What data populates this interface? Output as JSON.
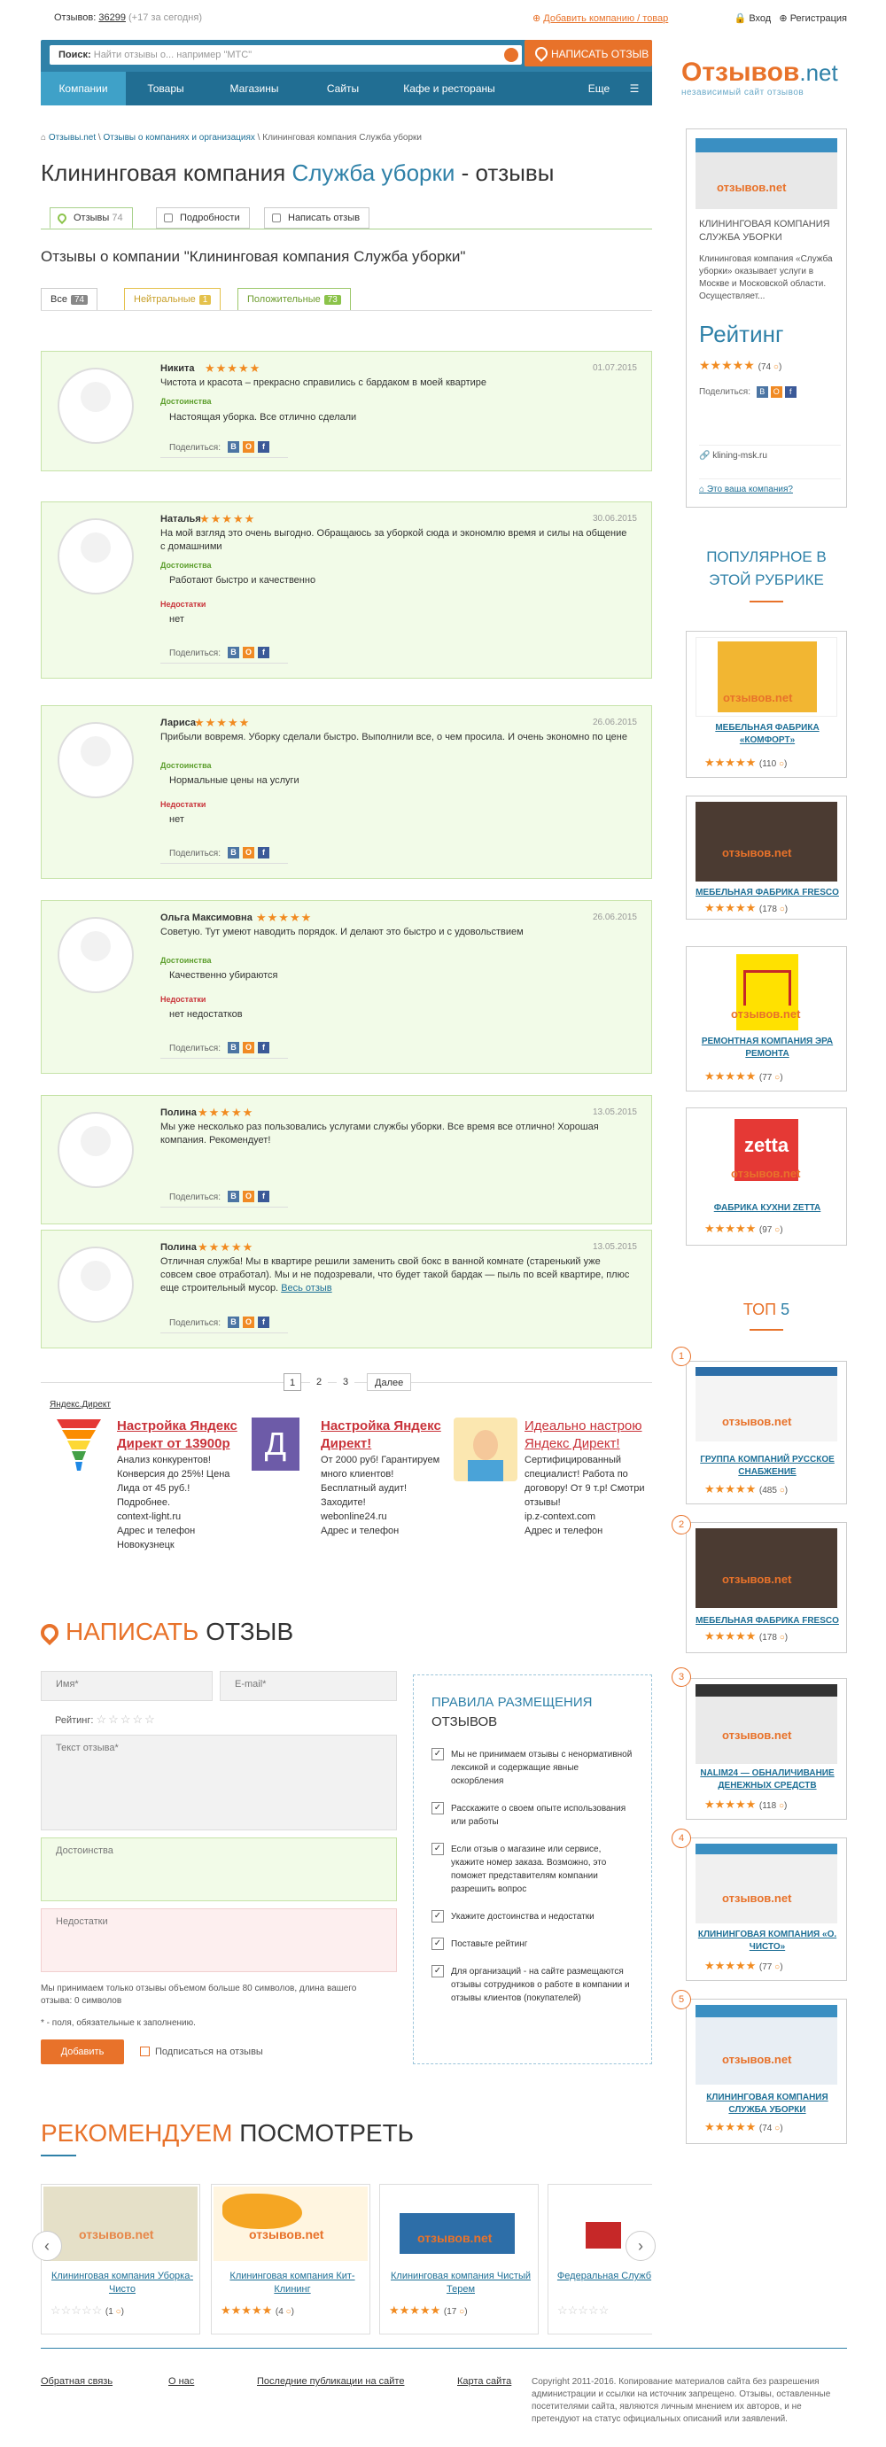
{
  "topbar": {
    "reviews_label": "Отзывов:",
    "reviews_count": "36299",
    "today": "(+17 за сегодня)",
    "add_company": "Добавить компанию / товар",
    "login": "Вход",
    "register": "Регистрация"
  },
  "search": {
    "label": "Поиск:",
    "placeholder": "Найти отзывы о... например \"МТС\"",
    "add_review": "НАПИСАТЬ ОТЗЫВ"
  },
  "nav": [
    "Компании",
    "Товары",
    "Магазины",
    "Сайты",
    "Кафе и рестораны",
    "Еще"
  ],
  "logo": {
    "main": "Отзывов",
    "suffix": ".net",
    "tagline": "независимый сайт отзывов"
  },
  "breadcrumbs": [
    "Отзывы.net",
    "Отзывы о компаниях и организациях",
    "Клининговая компания Служба уборки"
  ],
  "title": {
    "prefix": "Клининговая компания",
    "name": "Служба уборки",
    "suffix": "- отзывы"
  },
  "tabs": [
    {
      "label": "Отзывы",
      "count": "74"
    },
    {
      "label": "Подробности"
    },
    {
      "label": "Написать отзыв"
    }
  ],
  "section_title": "Отзывы о компании \"Клининговая компания Служба уборки\"",
  "filters": [
    {
      "label": "Все",
      "count": "74"
    },
    {
      "label": "Нейтральные",
      "count": "1"
    },
    {
      "label": "Положительные",
      "count": "73"
    }
  ],
  "share_label": "Поделиться:",
  "pros_label": "Достоинства",
  "cons_label": "Недостатки",
  "reviews": [
    {
      "name": "Никита",
      "date": "01.07.2015",
      "text": "Чистота и красота – прекрасно справились с бардаком в моей квартире",
      "pros": "Настоящая уборка. Все отлично сделали",
      "cons": ""
    },
    {
      "name": "Наталья",
      "date": "30.06.2015",
      "text": "На мой взгляд это очень выгодно. Обращаюсь за уборкой сюда и экономлю время и силы на общение с домашними",
      "pros": "Работают быстро и качественно",
      "cons": "нет"
    },
    {
      "name": "Лариса",
      "date": "26.06.2015",
      "text": "Прибыли вовремя. Уборку сделали быстро. Выполнили все, о чем просила. И очень экономно по цене",
      "pros": "Нормальные цены на услуги",
      "cons": "нет"
    },
    {
      "name": "Ольга Максимовна",
      "date": "26.06.2015",
      "text": "Советую. Тут умеют наводить порядок. И делают это быстро и с удовольствием",
      "pros": "Качественно убираются",
      "cons": "нет недостатков"
    },
    {
      "name": "Полина",
      "date": "13.05.2015",
      "text": "Мы уже несколько раз пользовались услугами службы уборки. Все время все отлично! Хорошая компания. Рекомендует!",
      "pros": "",
      "cons": ""
    },
    {
      "name": "Полина",
      "date": "13.05.2015",
      "text": "Отличная служба! Мы в квартире решили заменить свой бокс в ванной комнате (старенький уже совсем свое отработал). Мы и не подозревали, что будет такой бардак — пыль по всей квартире, плюс еще строительный мусор.",
      "more": "Весь отзыв",
      "pros": "",
      "cons": ""
    }
  ],
  "pager": {
    "pages": [
      "1",
      "2",
      "3"
    ],
    "next": "Далее"
  },
  "ads": {
    "label": "Яндекс.Директ",
    "items": [
      {
        "title": "Настройка Яндекс Директ от 13900р",
        "text": "Анализ конкурентов! Конверсия до 25%! Цена Лида от 45 руб.! Подробнее.",
        "site": "context-light.ru",
        "extra": "Адрес и телефон",
        "city": "Новокузнецк"
      },
      {
        "title": "Настройка Яндекс Директ!",
        "text": "От 2000 руб! Гарантируем много клиентов! Бесплатный аудит! Заходите!",
        "site": "webonline24.ru",
        "extra": "Адрес и телефон",
        "city": ""
      },
      {
        "title": "Идеально настрою Яндекс Директ!",
        "text": "Сертифицированный специалист! Работа по договору! От 9 т.р! Смотри отзывы!",
        "site": "ip.z-context.com",
        "extra": "Адрес и телефон",
        "city": ""
      }
    ]
  },
  "write": {
    "title_a": "НАПИСАТЬ",
    "title_b": "ОТЗЫВ",
    "name": "Имя*",
    "email": "E-mail*",
    "rating": "Рейтинг:",
    "text": "Текст отзыва*",
    "pros": "Достоинства",
    "cons": "Недостатки",
    "note": "Мы принимаем только отзывы объемом больше 80 символов, длина вашего отзыва: 0 символов",
    "req": "* - поля, обязательные к заполнению.",
    "submit": "Добавить",
    "subscribe": "Подписаться на отзывы"
  },
  "rules": {
    "title_a": "ПРАВИЛА РАЗМЕЩЕНИЯ",
    "title_b": "ОТЗЫВОВ",
    "items": [
      "Мы не принимаем отзывы с ненормативной лексикой и содержащие явные оскорбления",
      "Расскажите о своем опыте использования или работы",
      "Если отзыв о магазине или сервисе, укажите номер заказа. Возможно, это поможет представителям компании разрешить вопрос",
      "Укажите достоинства и недостатки",
      "Поставьте рейтинг",
      "Для организаций - на сайте размещаются отзывы сотрудников о работе в компании и отзывы клиентов (покупателей)"
    ]
  },
  "recommend": {
    "title_a": "РЕКОМЕНДУЕМ",
    "title_b": "ПОСМОТРЕТЬ",
    "items": [
      {
        "name": "Клининговая компания Уборка-Чисто",
        "count": "1",
        "stars": 0
      },
      {
        "name": "Клининговая компания Кит-Клининг",
        "count": "4",
        "stars": 5
      },
      {
        "name": "Клининговая компания Чистый Терем",
        "count": "17",
        "stars": 5
      },
      {
        "name": "Федеральная Служб",
        "count": "",
        "stars": 0
      }
    ]
  },
  "footer": {
    "links": [
      "Обратная связь",
      "О нас",
      "Последние публикации на сайте",
      "Карта сайта"
    ],
    "copyright": "Copyright 2011-2016. Копирование материалов сайта без разрешения администрации и ссылки на источник запрещено. Отзывы, оставленные посетителями сайта, являются личным мнением их авторов, и не претендуют на статус официальных описаний или заявлений."
  },
  "sidebar": {
    "company": {
      "name": "КЛИНИНГОВАЯ КОМПАНИЯ СЛУЖБА УБОРКИ",
      "desc": "Клининговая компания «Служба уборки» оказывает услуги в Москве и Московской области. Осуществляет...",
      "rating_label": "Рейтинг",
      "rating_count": "74",
      "share": "Поделиться:",
      "site": "klining-msk.ru",
      "owner": "Это ваша компания?"
    },
    "popular_title_a": "ПОПУЛЯРНОЕ В",
    "popular_title_b": "ЭТОЙ РУБРИКЕ",
    "popular": [
      {
        "name": "МЕБЕЛЬНАЯ ФАБРИКА «КОМФОРТ»",
        "count": "110"
      },
      {
        "name": "МЕБЕЛЬНАЯ ФАБРИКА FRESCO",
        "count": "178"
      },
      {
        "name": "РЕМОНТНАЯ КОМПАНИЯ ЭРА РЕМОНТА",
        "count": "77"
      },
      {
        "name": "ФАБРИКА КУХНИ ZETTA",
        "count": "97"
      }
    ],
    "top_title_a": "ТОП",
    "top_title_b": "5",
    "top": [
      {
        "n": "1",
        "name": "ГРУППА КОМПАНИЙ РУССКОЕ СНАБЖЕНИЕ",
        "count": "485"
      },
      {
        "n": "2",
        "name": "МЕБЕЛЬНАЯ ФАБРИКА FRESCO",
        "count": "178"
      },
      {
        "n": "3",
        "name": "NALIM24 — ОБНАЛИЧИВАНИЕ ДЕНЕЖНЫХ СРЕДСТВ",
        "count": "118"
      },
      {
        "n": "4",
        "name": "КЛИНИНГОВАЯ КОМПАНИЯ «О. ЧИСТО»",
        "count": "77"
      },
      {
        "n": "5",
        "name": "КЛИНИНГОВАЯ КОМПАНИЯ СЛУЖБА УБОРКИ",
        "count": "74"
      }
    ]
  },
  "watermark": "отзывов.net",
  "colors": {
    "accent": "#e8722a",
    "brand": "#2f81a8",
    "positive": "#8bc34a"
  }
}
